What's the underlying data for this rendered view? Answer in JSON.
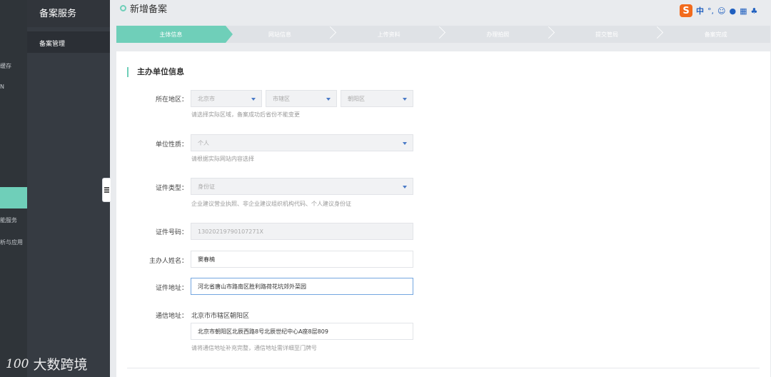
{
  "left_rail": {
    "items": [
      "缓存",
      "N",
      "能服务",
      "析与应用"
    ]
  },
  "sidebar": {
    "title": "备案服务",
    "items": [
      {
        "label": "备案管理"
      }
    ]
  },
  "header": {
    "title": "新增备案"
  },
  "ime": {
    "lang": "中",
    "punct": "°,"
  },
  "steps": [
    {
      "label": "主体信息",
      "active": true
    },
    {
      "label": "网站信息",
      "active": false
    },
    {
      "label": "上传资料",
      "active": false
    },
    {
      "label": "办理拍照",
      "active": false
    },
    {
      "label": "提交管局",
      "active": false
    },
    {
      "label": "备案完成",
      "active": false
    }
  ],
  "form": {
    "section_title": "主办单位信息",
    "region": {
      "label": "所在地区：",
      "province": "北京市",
      "city": "市辖区",
      "district": "朝阳区",
      "hint": "请选择实际区域，备案成功后省份不能变更"
    },
    "org_type": {
      "label": "单位性质：",
      "value": "个人",
      "hint": "请根据实际网站内容选择"
    },
    "id_type": {
      "label": "证件类型：",
      "value": "身份证",
      "hint": "企业建议营业执照、非企业建议组织机构代码、个人建议身份证"
    },
    "id_number": {
      "label": "证件号码：",
      "value": "13020219790107271X"
    },
    "owner_name": {
      "label": "主办人姓名：",
      "value": "窦春楠"
    },
    "id_address": {
      "label": "证件地址：",
      "value": "河北省唐山市路南区胜利路荷花坑郊外菜园"
    },
    "mail_address": {
      "label": "通信地址：",
      "region_text": "北京市市辖区朝阳区",
      "value": "北京市朝阳区北辰西路8号北辰世纪中心A座8层809",
      "hint": "请将通信地址补充完整，通信地址需详细至门牌号"
    }
  },
  "watermark": {
    "logo": "100",
    "text": "大数跨境"
  },
  "colors": {
    "accent": "#6fcfb9",
    "sidebar": "#363b42",
    "rail": "#2f3439"
  }
}
